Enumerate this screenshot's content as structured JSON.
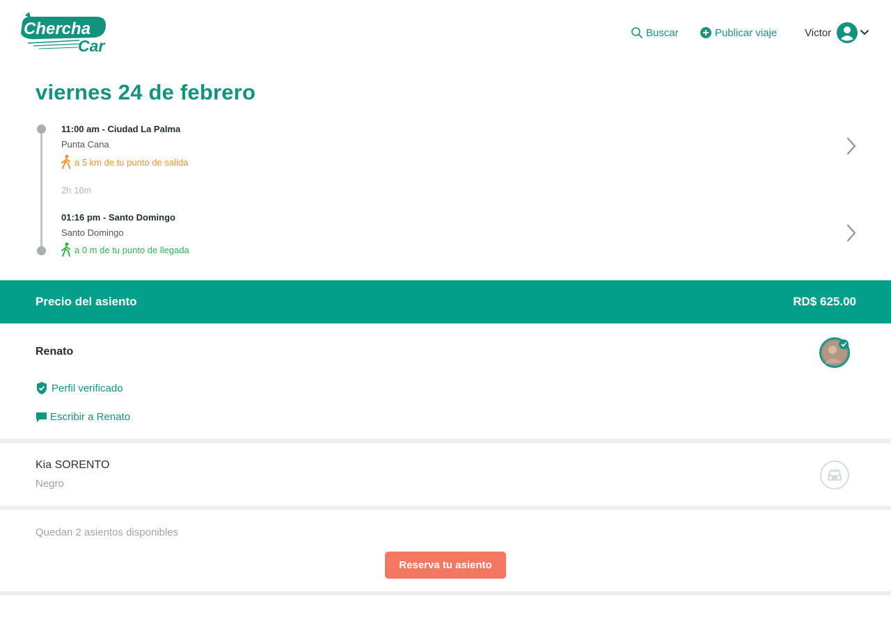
{
  "brand": {
    "line1": "Chercha",
    "line2": "Car",
    "color": "#12937d"
  },
  "nav": {
    "search_label": "Buscar",
    "publish_label": "Publicar viaje",
    "user_name": "Victor",
    "icons": {
      "search": "search-icon",
      "publish": "plus-circle-icon",
      "user": "user-avatar-icon",
      "menu": "chevron-down-icon"
    }
  },
  "trip": {
    "date": "viernes 24 de febrero",
    "departure": {
      "time_city": "11:00 am - Ciudad La Palma",
      "place": "Punta Cana",
      "distance": "a 5 km de tu punto de salida"
    },
    "duration": "2h 16m",
    "arrival": {
      "time_city": "01:16 pm - Santo Domingo",
      "place": "Santo Domingo",
      "distance": "a 0 m de tu punto de llegada"
    }
  },
  "price": {
    "label": "Precio del asiento",
    "value": "RD$ 625.00"
  },
  "driver": {
    "name": "Renato",
    "verified_label": "Perfil verificado",
    "message_label": "Escribir a Renato"
  },
  "vehicle": {
    "model": "Kia SORENTO",
    "color": "Negro"
  },
  "booking": {
    "seats_text": "Quedan 2 asientos disponibles",
    "reserve_label": "Reserva tu asiento"
  },
  "colors": {
    "accent": "#029f8a",
    "cta": "#f47762",
    "walk_far": "#f5932a",
    "walk_near": "#38b24a"
  }
}
